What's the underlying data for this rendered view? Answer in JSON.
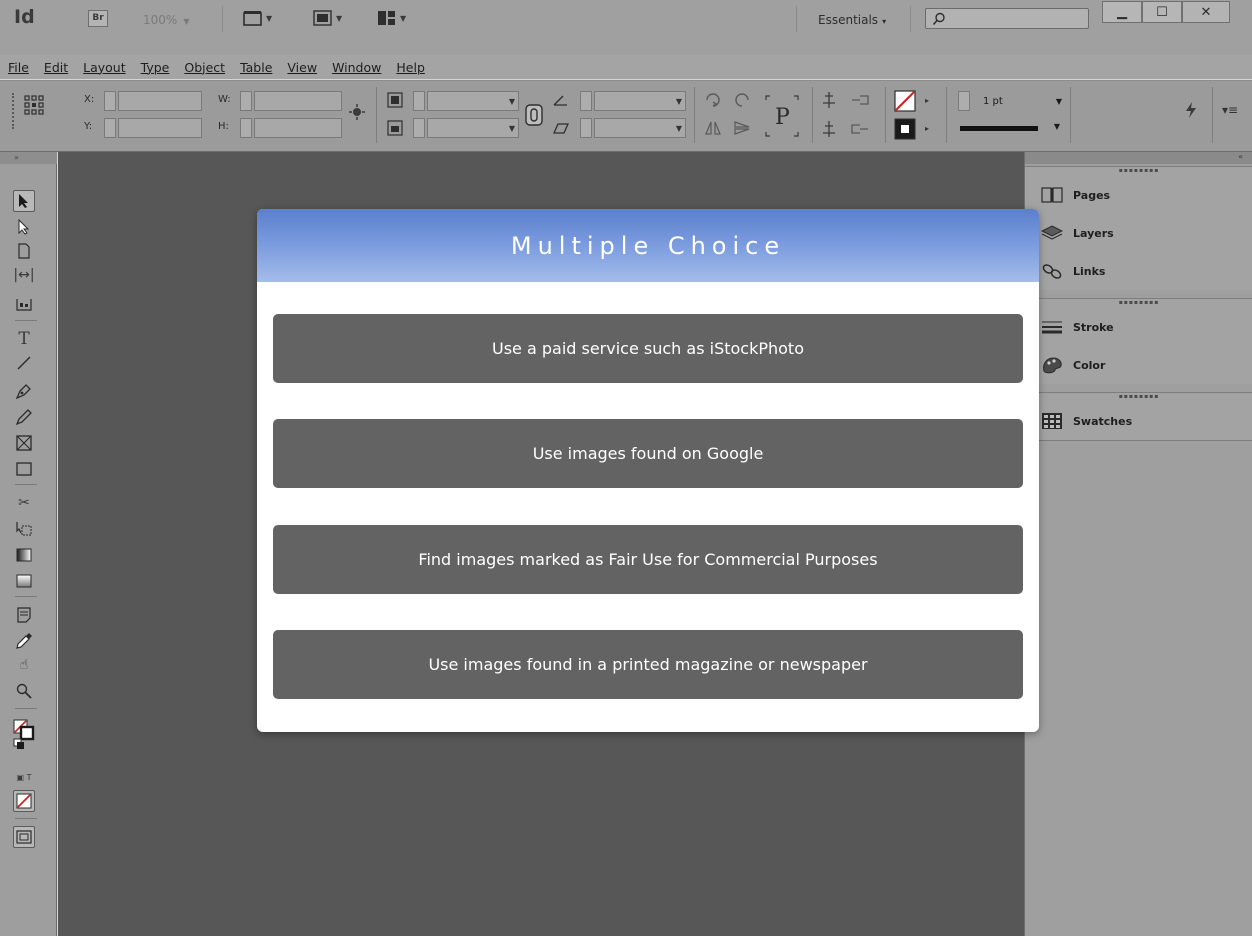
{
  "app": {
    "logo": "Id",
    "bridge_label": "Br",
    "zoom": "100%",
    "workspace": "Essentials",
    "search_placeholder": ""
  },
  "menu": [
    "File",
    "Edit",
    "Layout",
    "Type",
    "Object",
    "Table",
    "View",
    "Window",
    "Help"
  ],
  "control_panel": {
    "x_label": "X:",
    "y_label": "Y:",
    "w_label": "W:",
    "h_label": "H:",
    "stroke_weight": "1 pt"
  },
  "panels": [
    {
      "name": "Pages",
      "icon": "pages-icon"
    },
    {
      "name": "Layers",
      "icon": "layers-icon"
    },
    {
      "name": "Links",
      "icon": "links-icon"
    },
    {
      "name": "Stroke",
      "icon": "stroke-icon"
    },
    {
      "name": "Color",
      "icon": "color-icon"
    },
    {
      "name": "Swatches",
      "icon": "swatches-icon"
    }
  ],
  "quiz": {
    "title": "Multiple Choice",
    "options": [
      "Use a paid service such as iStockPhoto",
      "Use images found on Google",
      "Find images marked as Fair Use for Commercial Purposes",
      "Use images found in a printed magazine or newspaper"
    ]
  },
  "colors": {
    "header_gradient_top": "#5b7fcd",
    "header_gradient_bottom": "#a5bceb",
    "option_bg": "#636363",
    "canvas_bg": "#575757"
  }
}
